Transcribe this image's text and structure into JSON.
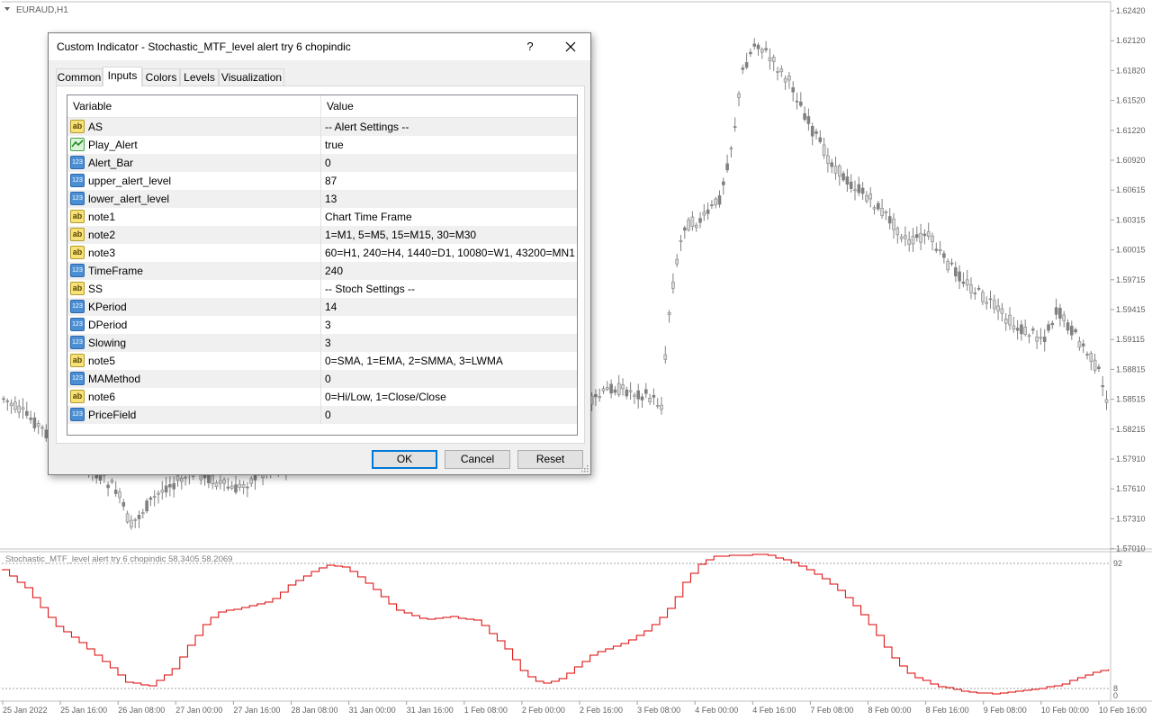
{
  "chart": {
    "symbol_label": "EURAUD,H1",
    "price_ticks": [
      "1.62420",
      "1.62120",
      "1.61820",
      "1.61520",
      "1.61220",
      "1.60920",
      "1.60615",
      "1.60315",
      "1.60015",
      "1.59715",
      "1.59415",
      "1.59115",
      "1.58815",
      "1.58515",
      "1.58215",
      "1.57910",
      "1.57610",
      "1.57310",
      "1.57010"
    ],
    "indicator_label": "Stochastic_MTF_level alert try 6 chopindic 58.3405 58.2069",
    "indicator_levels": [
      "92",
      "8",
      "0"
    ],
    "time_labels": [
      "25 Jan 2022",
      "25 Jan 16:00",
      "26 Jan 08:00",
      "27 Jan 00:00",
      "27 Jan 16:00",
      "28 Jan 08:00",
      "31 Jan 00:00",
      "31 Jan 16:00",
      "1 Feb 08:00",
      "2 Feb 00:00",
      "2 Feb 16:00",
      "3 Feb 08:00",
      "4 Feb 00:00",
      "4 Feb 16:00",
      "7 Feb 08:00",
      "8 Feb 00:00",
      "8 Feb 16:00",
      "9 Feb 08:00",
      "10 Feb 00:00",
      "10 Feb 16:00"
    ],
    "colors": {
      "candle": "#808080",
      "line": "#dd0000",
      "grid": "#c0c0c0",
      "text": "#606060"
    }
  },
  "dialog": {
    "title": "Custom Indicator - Stochastic_MTF_level alert try 6 chopindic",
    "help_label": "?",
    "tabs": [
      "Common",
      "Inputs",
      "Colors",
      "Levels",
      "Visualization"
    ],
    "active_tab": "Inputs",
    "columns": {
      "variable": "Variable",
      "value": "Value"
    },
    "rows": [
      {
        "icon": "ab",
        "name": "AS",
        "value": "-- Alert Settings --"
      },
      {
        "icon": "bool",
        "name": "Play_Alert",
        "value": "true"
      },
      {
        "icon": "123",
        "name": "Alert_Bar",
        "value": "0"
      },
      {
        "icon": "123",
        "name": "upper_alert_level",
        "value": "87"
      },
      {
        "icon": "123",
        "name": "lower_alert_level",
        "value": "13"
      },
      {
        "icon": "ab",
        "name": "note1",
        "value": "Chart Time Frame"
      },
      {
        "icon": "ab",
        "name": "note2",
        "value": "1=M1, 5=M5, 15=M15, 30=M30"
      },
      {
        "icon": "ab",
        "name": "note3",
        "value": "60=H1, 240=H4, 1440=D1, 10080=W1, 43200=MN1"
      },
      {
        "icon": "123",
        "name": "TimeFrame",
        "value": "240"
      },
      {
        "icon": "ab",
        "name": "SS",
        "value": "-- Stoch Settings --"
      },
      {
        "icon": "123",
        "name": "KPeriod",
        "value": "14"
      },
      {
        "icon": "123",
        "name": "DPeriod",
        "value": "3"
      },
      {
        "icon": "123",
        "name": "Slowing",
        "value": "3"
      },
      {
        "icon": "ab",
        "name": "note5",
        "value": "0=SMA, 1=EMA, 2=SMMA, 3=LWMA"
      },
      {
        "icon": "123",
        "name": "MAMethod",
        "value": "0"
      },
      {
        "icon": "ab",
        "name": "note6",
        "value": "0=Hi/Low, 1=Close/Close"
      },
      {
        "icon": "123",
        "name": "PriceField",
        "value": "0"
      }
    ],
    "buttons": {
      "ok": "OK",
      "cancel": "Cancel",
      "reset": "Reset"
    }
  }
}
